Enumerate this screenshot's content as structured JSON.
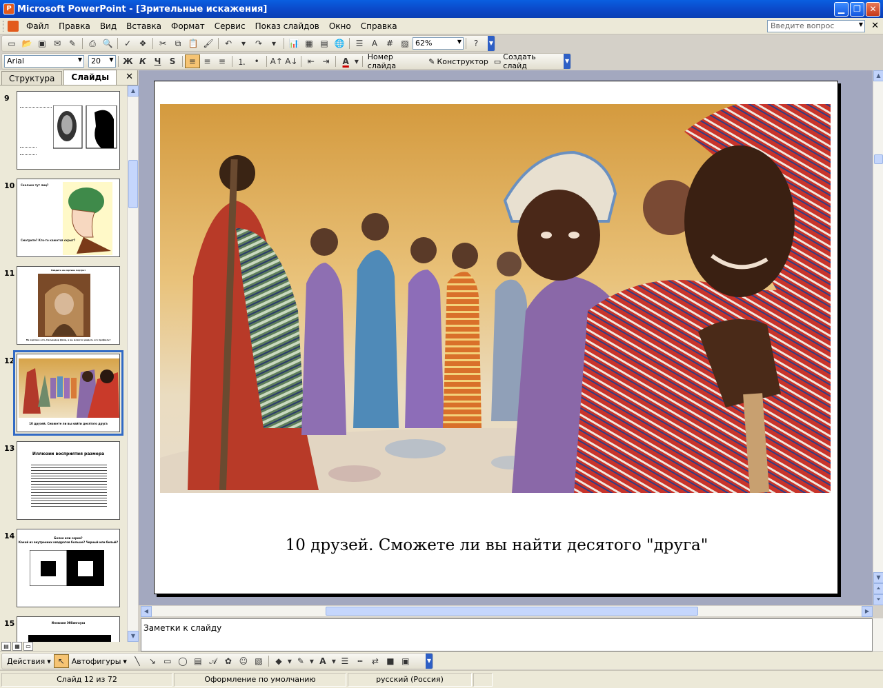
{
  "window": {
    "title": "Microsoft PowerPoint - [Зрительные искажения]",
    "app_icon": "P"
  },
  "menu": {
    "items": [
      "Файл",
      "Правка",
      "Вид",
      "Вставка",
      "Формат",
      "Сервис",
      "Показ слайдов",
      "Окно",
      "Справка"
    ],
    "help_placeholder": "Введите вопрос"
  },
  "toolbar_standard": {
    "zoom": "62%"
  },
  "toolbar_format": {
    "font": "Arial",
    "size": "20",
    "bold": "Ж",
    "italic": "К",
    "underline": "Ч",
    "shadow": "S",
    "slide_layout_label": "Номер слайда",
    "design_label": "Конструктор",
    "new_slide_label": "Создать слайд"
  },
  "left_pane": {
    "tabs": [
      "Структура",
      "Слайды"
    ],
    "slides": [
      {
        "num": "9"
      },
      {
        "num": "10",
        "top_text": "Сколько тут лиц?",
        "bottom_text": "Смотрите? Кто-то кажется скрыт?"
      },
      {
        "num": "11",
        "top_text": "Найдите на картине портрет",
        "bottom_text": "На картине есть Сальвадор Дали, а вы можете увидеть его профиль?"
      },
      {
        "num": "12",
        "bottom_text": "10 друзей. Сможете ли вы найти десятого друга"
      },
      {
        "num": "13",
        "title": "Иллюзии восприятия размера"
      },
      {
        "num": "14",
        "title": "Белое или серое?",
        "subtitle": "Какой из внутренних квадратов больше? Черный или белый?"
      },
      {
        "num": "15",
        "title": "Иллюзия Эббингауза"
      }
    ]
  },
  "slide": {
    "caption": "10 друзей. Сможете ли вы найти десятого \"друга\""
  },
  "notes": {
    "placeholder": "Заметки к слайду"
  },
  "drawing_toolbar": {
    "actions_label": "Действия",
    "autoshapes_label": "Автофигуры"
  },
  "status": {
    "slide_counter": "Слайд 12 из 72",
    "design": "Оформление по умолчанию",
    "language": "русский (Россия)"
  },
  "colors": {
    "titlebar": "#0b4fd0",
    "selection": "#316ac5",
    "workspace": "#a3a8bf"
  }
}
